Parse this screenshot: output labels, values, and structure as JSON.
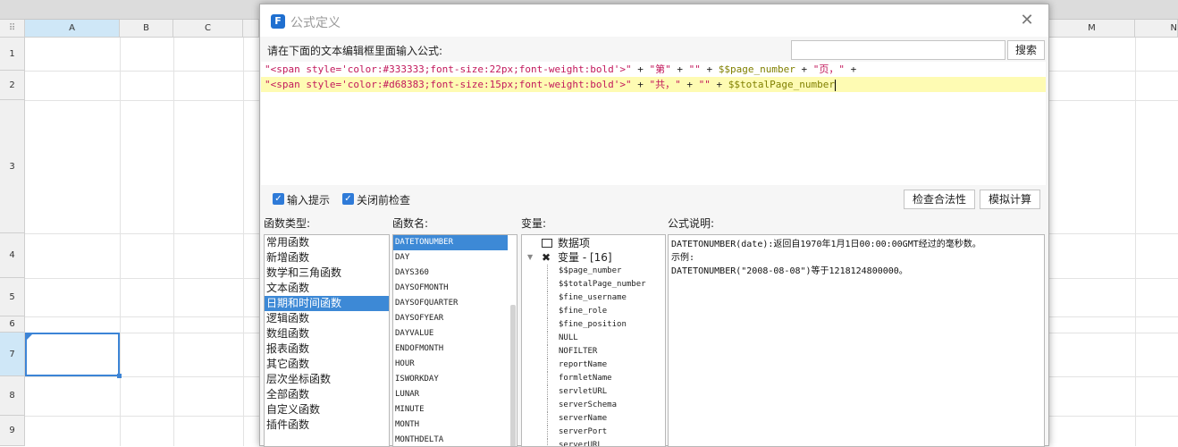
{
  "sheet": {
    "corner_icon": "grid-dots-icon",
    "columns": [
      "A",
      "B",
      "C",
      "M",
      "N"
    ],
    "rows": [
      "1",
      "2",
      "3",
      "4",
      "5",
      "6",
      "7",
      "8",
      "9"
    ],
    "selected_cell": "A7",
    "accent_color": "#3c84d6"
  },
  "dialog": {
    "title": "公式定义",
    "prompt": "请在下面的文本编辑框里面输入公式:",
    "search_value": "",
    "search_button": "搜索",
    "editor_lines": [
      [
        {
          "t": "\"<span style='color:#333333;font-size:22px;font-weight:bold'>\"",
          "c": "str"
        },
        {
          "t": " + ",
          "c": "op"
        },
        {
          "t": "\"第\"",
          "c": "str"
        },
        {
          "t": " + ",
          "c": "op"
        },
        {
          "t": "\"\"",
          "c": "str"
        },
        {
          "t": " + ",
          "c": "op"
        },
        {
          "t": "$$page_number",
          "c": "var"
        },
        {
          "t": " + ",
          "c": "op"
        },
        {
          "t": "\"页，\"",
          "c": "str"
        },
        {
          "t": " +",
          "c": "op"
        }
      ],
      [
        {
          "t": "\"<span style='color:#d68383;font-size:15px;font-weight:bold'>\"",
          "c": "str"
        },
        {
          "t": " + ",
          "c": "op"
        },
        {
          "t": "\"共，\"",
          "c": "str"
        },
        {
          "t": " + ",
          "c": "op"
        },
        {
          "t": "\"\"",
          "c": "str"
        },
        {
          "t": " + ",
          "c": "op"
        },
        {
          "t": "$$totalPage_number",
          "c": "var"
        }
      ]
    ],
    "current_line_color": "#fefbb3",
    "options": {
      "input_hint_label": "输入提示",
      "input_hint_checked": true,
      "check_before_close_label": "关闭前检查",
      "check_before_close_checked": true
    },
    "buttons": {
      "check_validity": "检查合法性",
      "simulate": "模拟计算"
    },
    "labels": {
      "func_type": "函数类型:",
      "func_name": "函数名:",
      "variables": "变量:",
      "description": "公式说明:"
    },
    "func_types": [
      "常用函数",
      "新增函数",
      "数学和三角函数",
      "文本函数",
      "日期和时间函数",
      "逻辑函数",
      "数组函数",
      "报表函数",
      "其它函数",
      "层次坐标函数",
      "全部函数",
      "自定义函数",
      "插件函数"
    ],
    "func_type_selected": 4,
    "func_names": [
      "DATETONUMBER",
      "DAY",
      "DAYS360",
      "DAYSOFMONTH",
      "DAYSOFQUARTER",
      "DAYSOFYEAR",
      "DAYVALUE",
      "ENDOFMONTH",
      "HOUR",
      "ISWORKDAY",
      "LUNAR",
      "MINUTE",
      "MONTH",
      "MONTHDELTA"
    ],
    "func_name_selected": 0,
    "var_groups": {
      "data_item": "数据项",
      "variable": "变量 - [16]"
    },
    "variables": [
      "$$page_number",
      "$$totalPage_number",
      "$fine_username",
      "$fine_role",
      "$fine_position",
      "NULL",
      "NOFILTER",
      "reportName",
      "formletName",
      "servletURL",
      "serverSchema",
      "serverName",
      "serverPort",
      "serverURL"
    ],
    "description_text": "DATETONUMBER(date):返回自1970年1月1日00:00:00GMT经过的毫秒数。\n示例:\nDATETONUMBER(\"2008-08-08\")等于1218124800000。",
    "selection_color": "#3d89d6"
  }
}
